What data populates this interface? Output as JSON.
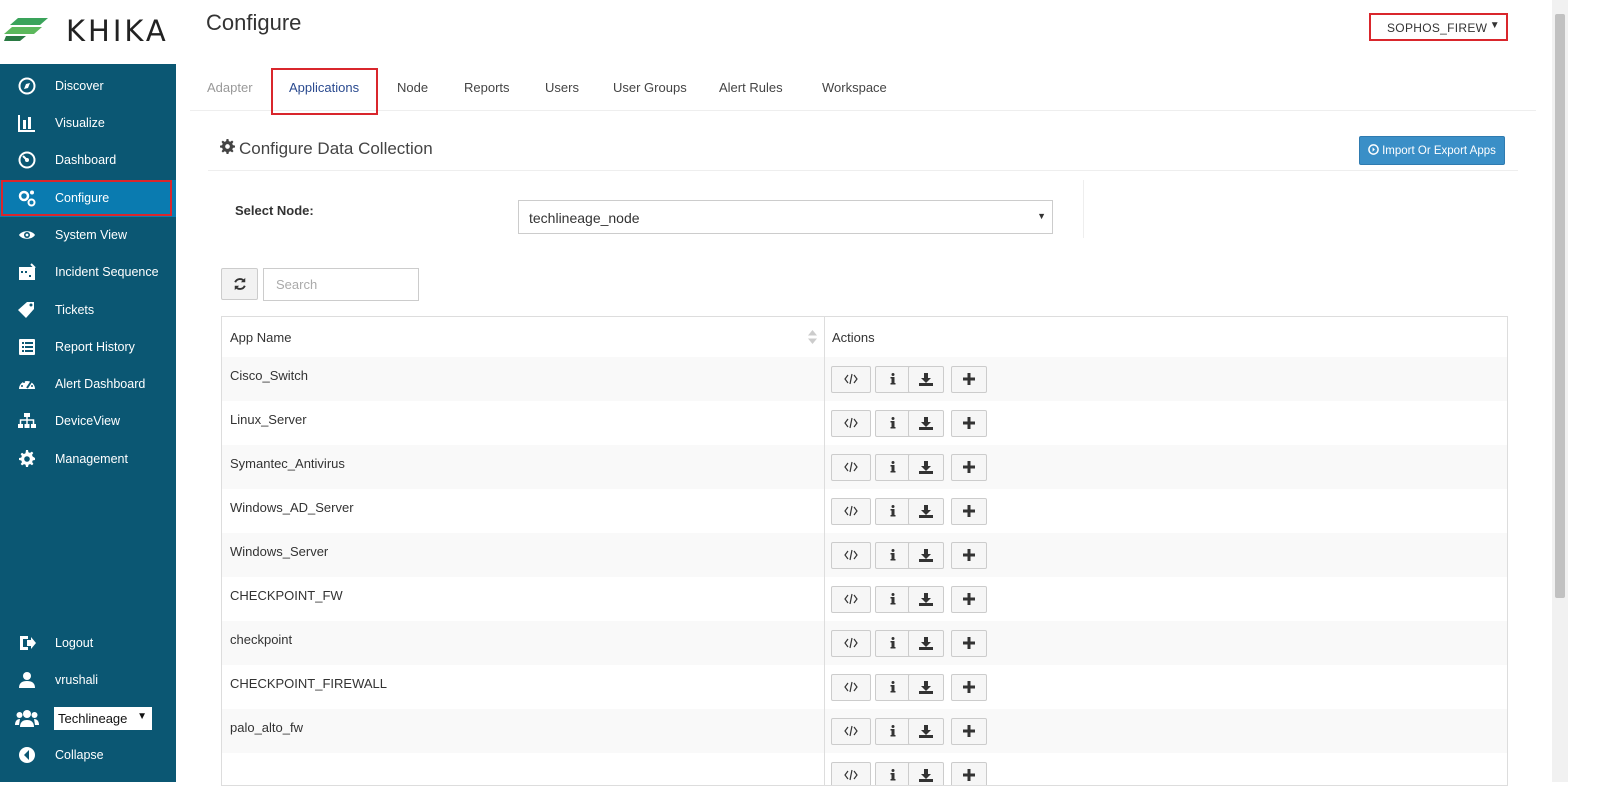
{
  "brand": {
    "logo_text": "KHIKA"
  },
  "sidebar": {
    "items": [
      {
        "label": "Discover",
        "icon": "compass-icon"
      },
      {
        "label": "Visualize",
        "icon": "bar-chart-icon"
      },
      {
        "label": "Dashboard",
        "icon": "dashboard-icon"
      },
      {
        "label": "Configure",
        "icon": "cogs-icon",
        "active": true
      },
      {
        "label": "System View",
        "icon": "eye-icon"
      },
      {
        "label": "Incident Sequence",
        "icon": "calendar-icon"
      },
      {
        "label": "Tickets",
        "icon": "tag-icon"
      },
      {
        "label": "Report History",
        "icon": "list-icon"
      },
      {
        "label": "Alert Dashboard",
        "icon": "tachometer-icon"
      },
      {
        "label": "DeviceView",
        "icon": "sitemap-icon"
      },
      {
        "label": "Management",
        "icon": "gear-icon"
      }
    ],
    "bottom": [
      {
        "label": "Logout",
        "icon": "sign-out-icon"
      },
      {
        "label": "vrushali",
        "icon": "user-icon"
      }
    ],
    "org_select": "Techlineage",
    "collapse_label": "Collapse"
  },
  "header": {
    "title": "Configure",
    "workspace_select": "SOPHOS_FIREW"
  },
  "tabs": [
    {
      "label": "Adapter",
      "state": "disabled"
    },
    {
      "label": "Applications",
      "state": "active"
    },
    {
      "label": "Node",
      "state": "normal"
    },
    {
      "label": "Reports",
      "state": "normal"
    },
    {
      "label": "Users",
      "state": "normal"
    },
    {
      "label": "User Groups",
      "state": "normal"
    },
    {
      "label": "Alert Rules",
      "state": "normal"
    },
    {
      "label": "Workspace",
      "state": "normal"
    }
  ],
  "section": {
    "title": "Configure Data Collection",
    "import_export_label": "Import Or Export Apps",
    "select_node_label": "Select Node:",
    "node_value": "techlineage_node",
    "search_placeholder": "Search"
  },
  "table": {
    "columns": [
      "App Name",
      "Actions"
    ],
    "rows": [
      "Cisco_Switch",
      "Linux_Server",
      "Symantec_Antivirus",
      "Windows_AD_Server",
      "Windows_Server",
      "CHECKPOINT_FW",
      "checkpoint",
      "CHECKPOINT_FIREWALL",
      "palo_alto_fw"
    ],
    "actions": [
      "code-icon",
      "info-icon",
      "download-icon",
      "plus-icon"
    ]
  },
  "colors": {
    "sidebar": "#0b5773",
    "sidebar_active": "#0a7bb0",
    "highlight_border": "#d9262c",
    "primary_button": "#3a8fc7"
  }
}
